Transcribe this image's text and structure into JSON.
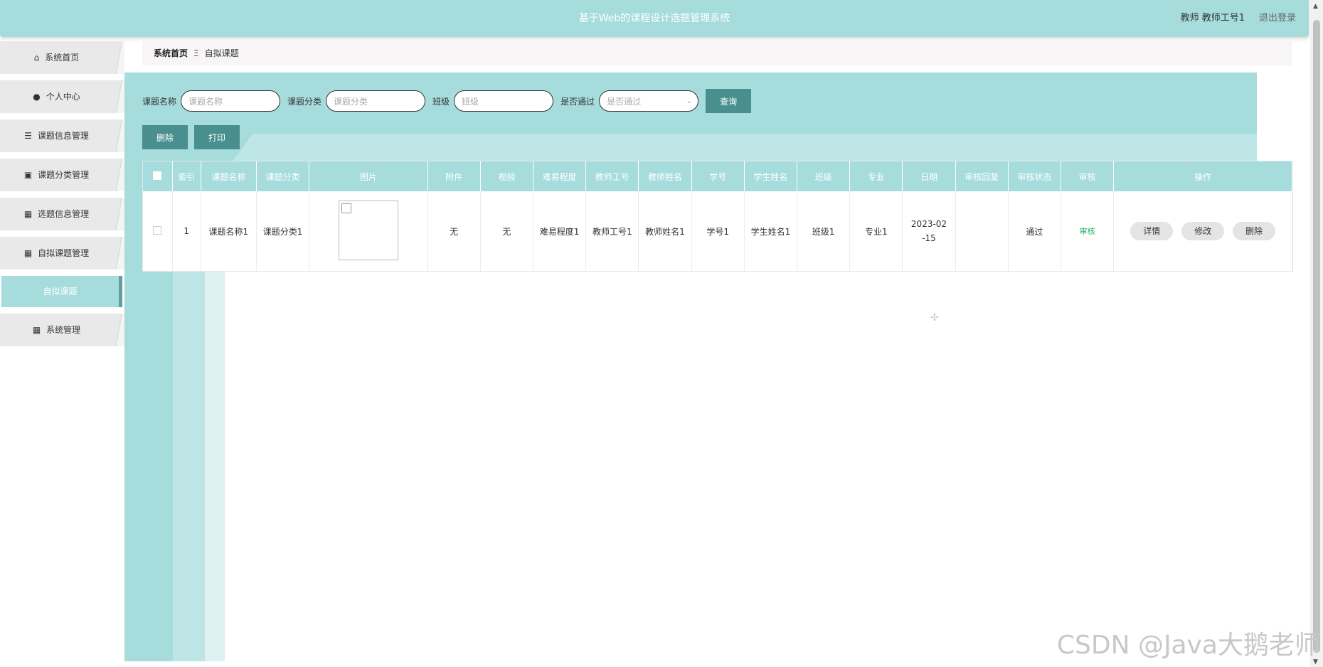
{
  "header": {
    "title": "基于Web的课程设计选题管理系统",
    "user": "教师 教师工号1",
    "logout": "退出登录"
  },
  "sidebar": {
    "items": [
      {
        "label": "系统首页",
        "icon": "home-icon",
        "glyph": "⌂"
      },
      {
        "label": "个人中心",
        "icon": "user-icon",
        "glyph": "●"
      },
      {
        "label": "课题信息管理",
        "icon": "sliders-icon",
        "glyph": "☰"
      },
      {
        "label": "课题分类管理",
        "icon": "clipboard-icon",
        "glyph": "▣"
      },
      {
        "label": "选题信息管理",
        "icon": "grid-icon",
        "glyph": "▦"
      },
      {
        "label": "自拟课题管理",
        "icon": "grid-icon",
        "glyph": "▦"
      }
    ],
    "sub_item": "自拟课题",
    "last_item": {
      "label": "系统管理",
      "icon": "apps-icon",
      "glyph": "▦"
    }
  },
  "breadcrumb": {
    "home": "系统首页",
    "separator": "Ξ",
    "current": "自拟课题"
  },
  "search": {
    "name_label": "课题名称",
    "name_placeholder": "课题名称",
    "category_label": "课题分类",
    "category_placeholder": "课题分类",
    "class_label": "班级",
    "class_placeholder": "班级",
    "passed_label": "是否通过",
    "passed_placeholder": "是否通过",
    "query_button": "查询"
  },
  "actions": {
    "delete": "删除",
    "print": "打印"
  },
  "table": {
    "headers": [
      "索引",
      "课题名称",
      "课题分类",
      "图片",
      "附件",
      "视频",
      "难易程度",
      "教师工号",
      "教师姓名",
      "学号",
      "学生姓名",
      "班级",
      "专业",
      "日期",
      "审核回复",
      "审核状态",
      "审核",
      "操作"
    ],
    "rows": [
      {
        "index": "1",
        "name": "课题名称1",
        "category": "课题分类1",
        "attachment": "无",
        "video": "无",
        "difficulty": "难易程度1",
        "teacher_id": "教师工号1",
        "teacher_name": "教师姓名1",
        "student_id": "学号1",
        "student_name": "学生姓名1",
        "class": "班级1",
        "major": "专业1",
        "date": "2023-02-15",
        "reply": "",
        "status": "通过",
        "audit": "审核",
        "ops": {
          "detail": "详情",
          "edit": "修改",
          "delete": "删除"
        }
      }
    ]
  },
  "watermark": "CSDN @Java大鹅老师",
  "colors": {
    "accent": "#a6dcdc",
    "button": "#4a8f8f",
    "audit_link": "#21b36b"
  }
}
